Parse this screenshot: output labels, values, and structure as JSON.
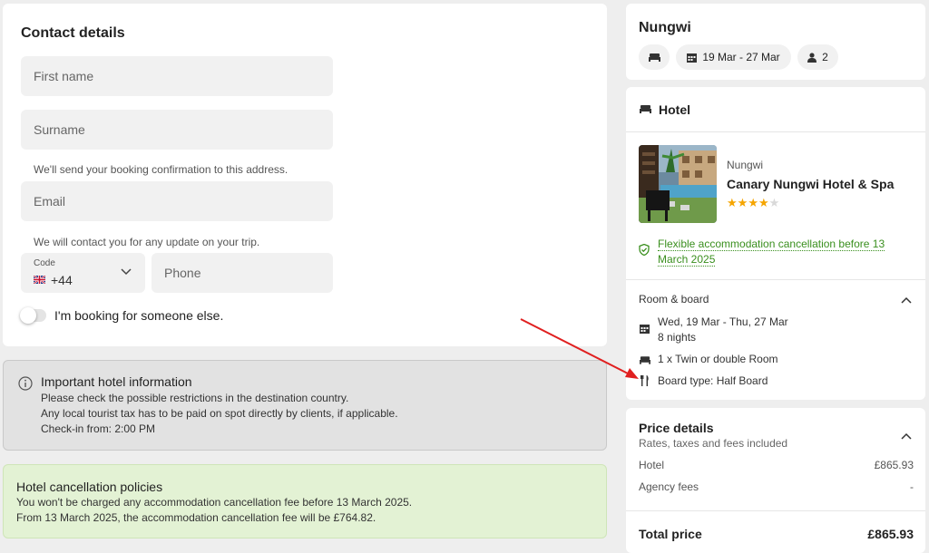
{
  "contact": {
    "title": "Contact details",
    "first_name_placeholder": "First name",
    "surname_placeholder": "Surname",
    "email_hint": "We'll send your booking confirmation to this address.",
    "email_placeholder": "Email",
    "phone_hint": "We will contact you for any update on your trip.",
    "code_label": "Code",
    "code_value": "+44",
    "phone_placeholder": "Phone",
    "toggle_label": "I'm booking for someone else."
  },
  "hotel_info": {
    "title": "Important hotel information",
    "lines": [
      "Please check the possible restrictions in the destination country.",
      "Any local tourist tax has to be paid on spot directly by clients, if applicable.",
      "Check-in from: 2:00 PM"
    ]
  },
  "cancellation": {
    "title": "Hotel cancellation policies",
    "lines": [
      "You won't be charged any accommodation cancellation fee before 13 March 2025.",
      "From 13 March 2025, the accommodation cancellation fee will be £764.82."
    ]
  },
  "summary": {
    "destination": "Nungwi",
    "dates": "19 Mar - 27 Mar",
    "guests": "2"
  },
  "hotel": {
    "section_title": "Hotel",
    "location": "Nungwi",
    "name": "Canary Nungwi Hotel & Spa",
    "stars": 4,
    "max_stars": 5,
    "flexible_text_1": "Flexible accommodation cancellation before 13",
    "flexible_text_2": "March 2025",
    "room_board_title": "Room & board",
    "dates_line": "Wed, 19 Mar - Thu, 27 Mar",
    "nights": "8 nights",
    "room": "1 x Twin or double Room",
    "board": "Board type: Half Board"
  },
  "price": {
    "title": "Price details",
    "subtitle": "Rates, taxes and fees included",
    "hotel_label": "Hotel",
    "hotel_value": "£865.93",
    "agency_label": "Agency fees",
    "agency_value": "-",
    "total_label": "Total price",
    "total_value": "£865.93"
  },
  "colors": {
    "success_green": "#3a8f1e",
    "annotation_red": "#e02020",
    "star_gold": "#f5a500"
  }
}
